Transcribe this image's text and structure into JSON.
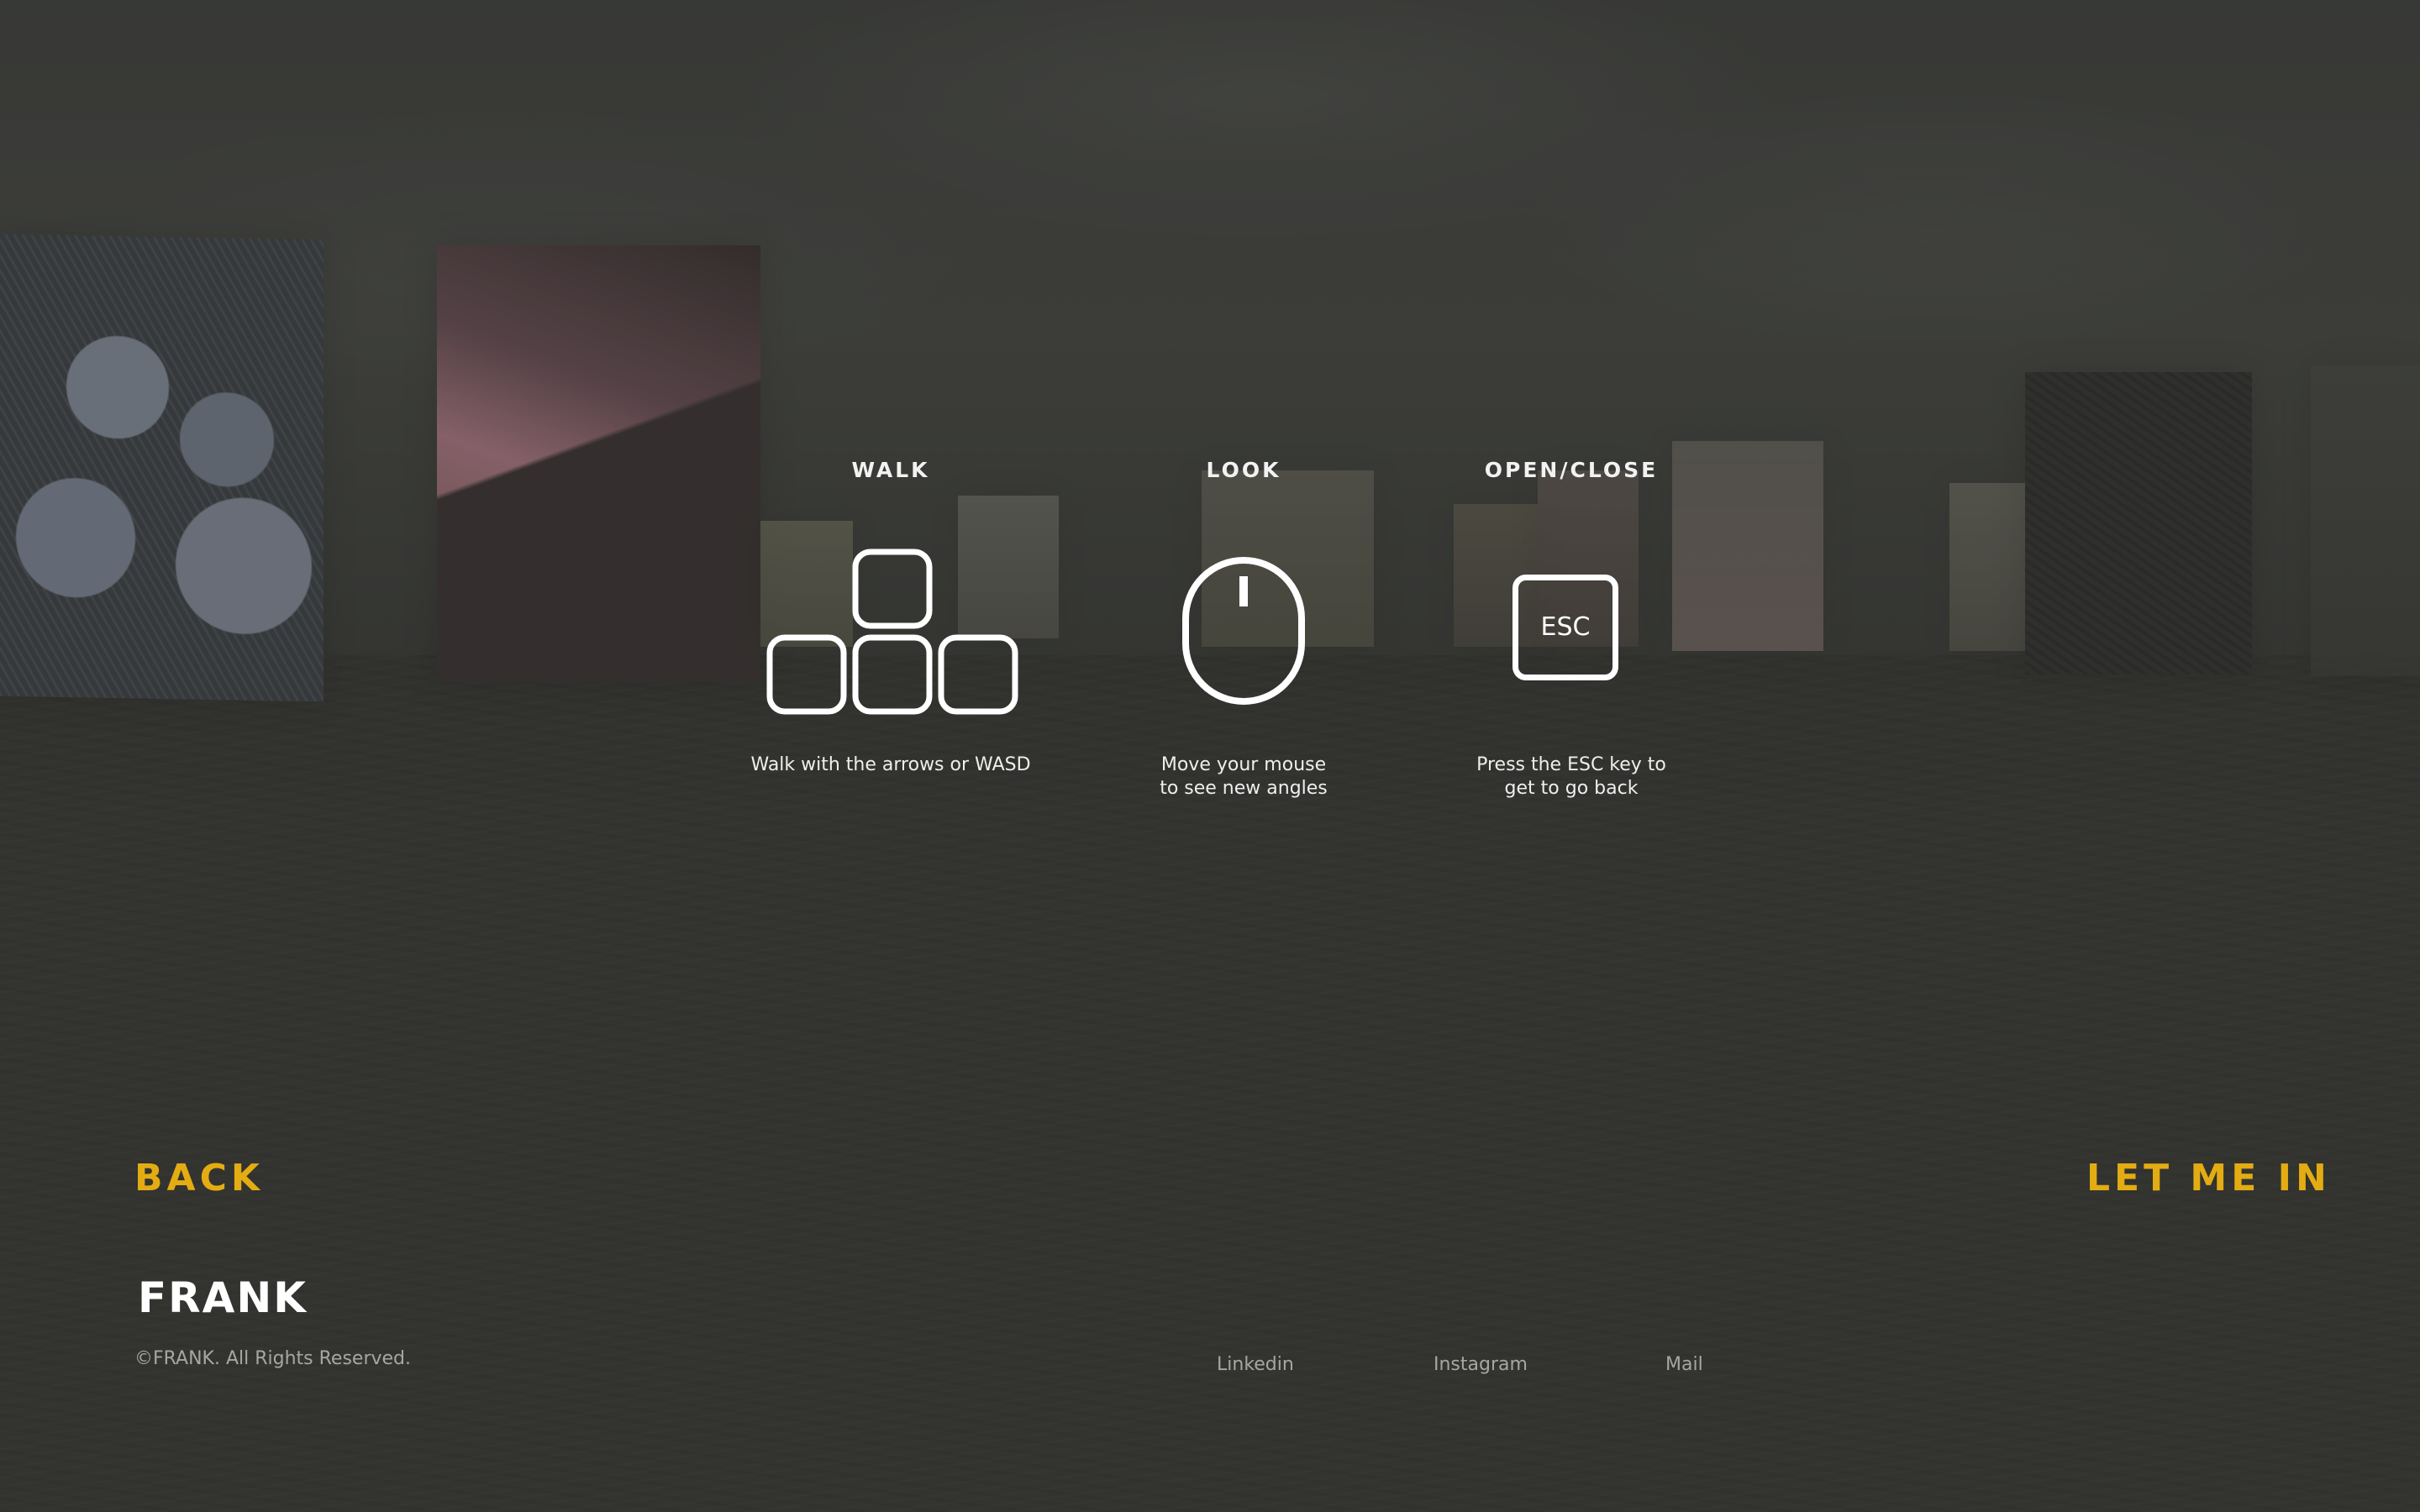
{
  "instructions": [
    {
      "title": "WALK",
      "icon": "keyboard-keys-icon",
      "text": "Walk with the arrows or WASD"
    },
    {
      "title": "LOOK",
      "icon": "mouse-icon",
      "text": "Move your mouse\nto see new angles"
    },
    {
      "title": "OPEN/CLOSE",
      "icon": "esc-key-icon",
      "key_label": "ESC",
      "text": "Press the ESC key to\nget to go back"
    }
  ],
  "nav": {
    "back_label": "BACK",
    "enter_label": "LET ME IN"
  },
  "footer": {
    "logo_text": "FRANK",
    "copyright": "©FRANK. All Rights Reserved.",
    "social": [
      "Linkedin",
      "Instagram",
      "Mail"
    ]
  },
  "colors": {
    "accent": "#e3ac12",
    "text": "#ffffff",
    "muted_text": "#a6a6a2",
    "overlay": "#3a3b38"
  }
}
